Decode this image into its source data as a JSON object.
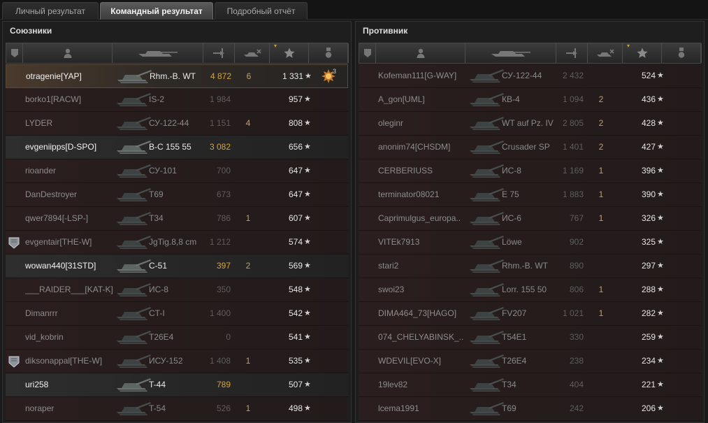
{
  "tabs": [
    "Личный результат",
    "Командный результат",
    "Подробный отчёт"
  ],
  "active_tab": 1,
  "allies": {
    "title": "Союзники",
    "rows": [
      {
        "badge": "",
        "name": "otragenie[YAP]",
        "vehicle": "Rhm.-B. WT",
        "damage": "4 872",
        "kills": "6",
        "xp": "1 331",
        "medal": "3",
        "highlight": true,
        "top": true
      },
      {
        "badge": "",
        "name": "borko1[RACW]",
        "vehicle": "IS-2",
        "damage": "1 984",
        "kills": "",
        "xp": "957",
        "medal": "",
        "highlight": false
      },
      {
        "badge": "",
        "name": "LYDER",
        "vehicle": "СУ-122-44",
        "damage": "1 151",
        "kills": "4",
        "xp": "808",
        "medal": "",
        "highlight": false
      },
      {
        "badge": "",
        "name": "evgeniipps[D-SPO]",
        "vehicle": "B-C 155 55",
        "damage": "3 082",
        "kills": "",
        "xp": "656",
        "medal": "",
        "highlight": true
      },
      {
        "badge": "",
        "name": "rioander",
        "vehicle": "СУ-101",
        "damage": "700",
        "kills": "",
        "xp": "647",
        "medal": "",
        "highlight": false
      },
      {
        "badge": "",
        "name": "DanDestroyer",
        "vehicle": "T69",
        "damage": "673",
        "kills": "",
        "xp": "647",
        "medal": "",
        "highlight": false
      },
      {
        "badge": "",
        "name": "qwer7894[-LSP-]",
        "vehicle": "T34",
        "damage": "786",
        "kills": "1",
        "xp": "607",
        "medal": "",
        "highlight": false
      },
      {
        "badge": "shield",
        "name": "evgentair[THE-W]",
        "vehicle": "JgTig.8,8 cm",
        "damage": "1 212",
        "kills": "",
        "xp": "574",
        "medal": "",
        "highlight": false
      },
      {
        "badge": "",
        "name": "wowan440[31STD]",
        "vehicle": "C-51",
        "damage": "397",
        "kills": "2",
        "xp": "569",
        "medal": "",
        "highlight": true
      },
      {
        "badge": "",
        "name": "___RAIDER___[KAT-K]",
        "vehicle": "ИС-8",
        "damage": "350",
        "kills": "",
        "xp": "548",
        "medal": "",
        "highlight": false
      },
      {
        "badge": "",
        "name": "Dimanrrr",
        "vehicle": "CT-I",
        "damage": "1 400",
        "kills": "",
        "xp": "542",
        "medal": "",
        "highlight": false
      },
      {
        "badge": "",
        "name": "vid_kobrin",
        "vehicle": "T26E4",
        "damage": "0",
        "kills": "",
        "xp": "541",
        "medal": "",
        "highlight": false
      },
      {
        "badge": "shield",
        "name": "diksonappal[THE-W]",
        "vehicle": "ИСУ-152",
        "damage": "1 408",
        "kills": "1",
        "xp": "535",
        "medal": "",
        "highlight": false
      },
      {
        "badge": "",
        "name": "uri258",
        "vehicle": "T-44",
        "damage": "789",
        "kills": "",
        "xp": "507",
        "medal": "",
        "highlight": true
      },
      {
        "badge": "",
        "name": "noraper",
        "vehicle": "T-54",
        "damage": "526",
        "kills": "1",
        "xp": "498",
        "medal": "",
        "highlight": false
      }
    ]
  },
  "enemies": {
    "title": "Противник",
    "rows": [
      {
        "badge": "",
        "name": "Kofeman111[G-WAY]",
        "vehicle": "СУ-122-44",
        "damage": "2 432",
        "kills": "",
        "xp": "524",
        "medal": "",
        "highlight": false
      },
      {
        "badge": "",
        "name": "A_gon[UML]",
        "vehicle": "КВ-4",
        "damage": "1 094",
        "kills": "2",
        "xp": "436",
        "medal": "",
        "highlight": false
      },
      {
        "badge": "",
        "name": "oleginr",
        "vehicle": "WT auf Pz. IV",
        "damage": "2 805",
        "kills": "2",
        "xp": "428",
        "medal": "",
        "highlight": false
      },
      {
        "badge": "",
        "name": "anonim74[CHSDM]",
        "vehicle": "Crusader SP",
        "damage": "1 401",
        "kills": "2",
        "xp": "427",
        "medal": "",
        "highlight": false
      },
      {
        "badge": "",
        "name": "CERBERIUSS",
        "vehicle": "ИС-8",
        "damage": "1 169",
        "kills": "1",
        "xp": "396",
        "medal": "",
        "highlight": false
      },
      {
        "badge": "",
        "name": "terminator08021",
        "vehicle": "E 75",
        "damage": "1 883",
        "kills": "1",
        "xp": "390",
        "medal": "",
        "highlight": false
      },
      {
        "badge": "",
        "name": "Caprimulgus_europa..",
        "vehicle": "ИС-6",
        "damage": "767",
        "kills": "1",
        "xp": "326",
        "medal": "",
        "highlight": false
      },
      {
        "badge": "",
        "name": "VITEk7913",
        "vehicle": "Löwe",
        "damage": "902",
        "kills": "",
        "xp": "325",
        "medal": "",
        "highlight": false
      },
      {
        "badge": "",
        "name": "stari2",
        "vehicle": "Rhm.-B. WT",
        "damage": "890",
        "kills": "",
        "xp": "297",
        "medal": "",
        "highlight": false
      },
      {
        "badge": "",
        "name": "swoi23",
        "vehicle": "Lorr. 155 50",
        "damage": "806",
        "kills": "1",
        "xp": "288",
        "medal": "",
        "highlight": false
      },
      {
        "badge": "",
        "name": "DIMA464_73[HAGO]",
        "vehicle": "FV207",
        "damage": "1 021",
        "kills": "1",
        "xp": "282",
        "medal": "",
        "highlight": false
      },
      {
        "badge": "",
        "name": "074_CHELYABINSK_..",
        "vehicle": "T54E1",
        "damage": "330",
        "kills": "",
        "xp": "259",
        "medal": "",
        "highlight": false
      },
      {
        "badge": "",
        "name": "WDEVIL[EVO-X]",
        "vehicle": "T26E4",
        "damage": "238",
        "kills": "",
        "xp": "234",
        "medal": "",
        "highlight": false
      },
      {
        "badge": "",
        "name": "19lev82",
        "vehicle": "T34",
        "damage": "404",
        "kills": "",
        "xp": "221",
        "medal": "",
        "highlight": false
      },
      {
        "badge": "",
        "name": "lcema1991",
        "vehicle": "T69",
        "damage": "242",
        "kills": "",
        "xp": "206",
        "medal": "",
        "highlight": false
      }
    ]
  },
  "xp_star_glyph": "★",
  "colors": {
    "damage_highlight": "#d8a23c",
    "kills": "#bfa06a",
    "sort_marker": "#c8a238"
  },
  "icons": {
    "columns": [
      "squad-icon",
      "player-icon",
      "tank-icon",
      "damage-icon",
      "kills-icon",
      "xp-star-icon",
      "medal-icon"
    ],
    "row_badge": "shield-icon",
    "row_medal": "medal-sun-icon"
  }
}
